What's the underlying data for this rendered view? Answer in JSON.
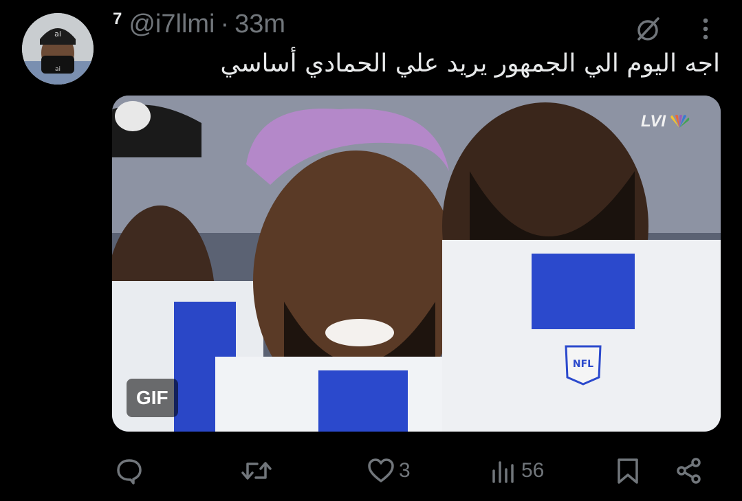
{
  "tweet": {
    "rank": "7",
    "handle": "@i7llmi",
    "separator": "·",
    "time": "33m",
    "avatar_text": "ai",
    "text": "اجه اليوم الي الجمهور يريد علي الحمادي أساسي"
  },
  "media": {
    "badge": "GIF",
    "broadcast_logo_text": "LVI",
    "jersey_logo_text": "NFL"
  },
  "actions": {
    "reply_count": "",
    "retweet_count": "",
    "like_count": "3",
    "views_count": "56"
  },
  "icons": {
    "header": [
      "grok-icon",
      "more-icon"
    ],
    "actions": [
      "reply-icon",
      "retweet-icon",
      "heart-icon",
      "views-icon",
      "bookmark-icon",
      "share-icon"
    ]
  },
  "colors": {
    "background": "#000000",
    "text_primary": "#e7e9ea",
    "text_secondary": "#71767b"
  }
}
